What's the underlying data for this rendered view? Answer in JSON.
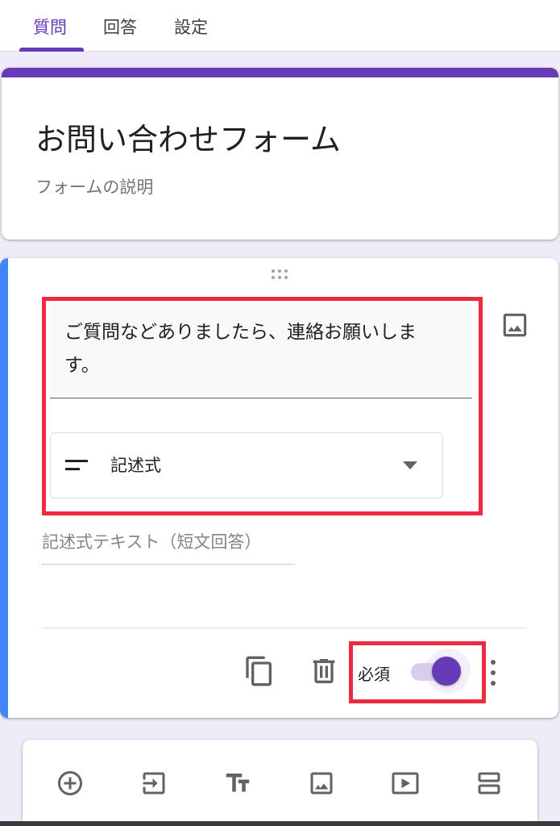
{
  "tabs": [
    {
      "label": "質問",
      "active": true
    },
    {
      "label": "回答",
      "active": false
    },
    {
      "label": "設定",
      "active": false
    }
  ],
  "form": {
    "title": "お問い合わせフォーム",
    "description_placeholder": "フォームの説明"
  },
  "question": {
    "text": "ご質問などありましたら、連絡お願いします。",
    "type_icon": "short-answer-lines-icon",
    "type_label": "記述式",
    "answer_hint": "記述式テキスト（短文回答）",
    "required_label": "必須",
    "required": true
  },
  "toolbar": {
    "items": [
      "add-question-icon",
      "import-questions-icon",
      "add-title-icon",
      "add-image-icon",
      "add-video-icon",
      "add-section-icon"
    ]
  },
  "colors": {
    "accent": "#673ab7",
    "active_question_bar": "#4285f4",
    "highlight_box": "#ee2a3f",
    "background": "#f0ebf8"
  }
}
